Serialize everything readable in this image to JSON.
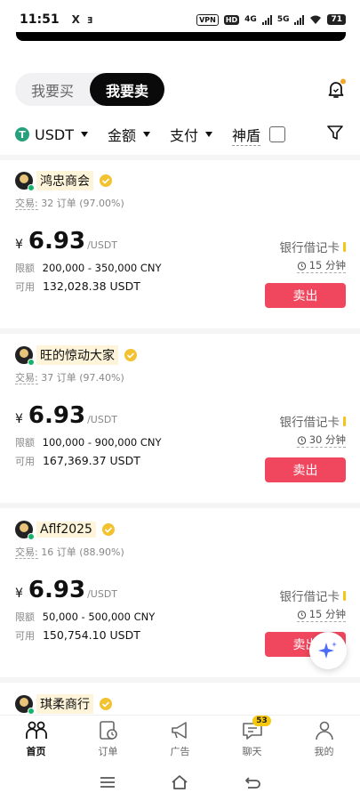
{
  "status": {
    "time": "11:51",
    "left_icons": [
      "X",
      "ⱻ"
    ],
    "vpn": "VPN",
    "hd": "HD",
    "net1": "4G",
    "net2": "5G",
    "battery": "71"
  },
  "toggle": {
    "buy": "我要买",
    "sell": "我要卖",
    "active": "sell"
  },
  "filters": {
    "coin": "USDT",
    "coin_icon": "T",
    "amount": "金额",
    "payment": "支付",
    "shield": "神盾"
  },
  "ads": [
    {
      "merchant": "鸿忠商会",
      "stats_label": "交易:",
      "orders": "32 订单",
      "rate": "(97.00%)",
      "currency_symbol": "¥",
      "price": "6.93",
      "unit": "/USDT",
      "limit_label": "限额",
      "limit": "200,000 - 350,000 CNY",
      "avail_label": "可用",
      "available": "132,028.38 USDT",
      "pay_method": "银行借记卡",
      "time_limit": "15 分钟",
      "action": "卖出"
    },
    {
      "merchant": "旺的惊动大家",
      "stats_label": "交易:",
      "orders": "37 订单",
      "rate": "(97.40%)",
      "currency_symbol": "¥",
      "price": "6.93",
      "unit": "/USDT",
      "limit_label": "限额",
      "limit": "100,000 - 900,000 CNY",
      "avail_label": "可用",
      "available": "167,369.37 USDT",
      "pay_method": "银行借记卡",
      "time_limit": "30 分钟",
      "action": "卖出"
    },
    {
      "merchant": "Aflf2025",
      "stats_label": "交易:",
      "orders": "16 订单",
      "rate": "(88.90%)",
      "currency_symbol": "¥",
      "price": "6.93",
      "unit": "/USDT",
      "limit_label": "限额",
      "limit": "50,000 - 500,000 CNY",
      "avail_label": "可用",
      "available": "150,754.10 USDT",
      "pay_method": "银行借记卡",
      "time_limit": "15 分钟",
      "action": "卖出"
    },
    {
      "merchant": "琪柔商行"
    }
  ],
  "nav": [
    {
      "label": "首页",
      "icon": "home-people-icon",
      "active": true
    },
    {
      "label": "订单",
      "icon": "orders-icon"
    },
    {
      "label": "广告",
      "icon": "megaphone-icon"
    },
    {
      "label": "聊天",
      "icon": "chat-icon",
      "badge": "53"
    },
    {
      "label": "我的",
      "icon": "profile-icon"
    }
  ],
  "colors": {
    "sell_button": "#f0475e",
    "accent_yellow": "#f5c518",
    "online": "#16b36b"
  }
}
